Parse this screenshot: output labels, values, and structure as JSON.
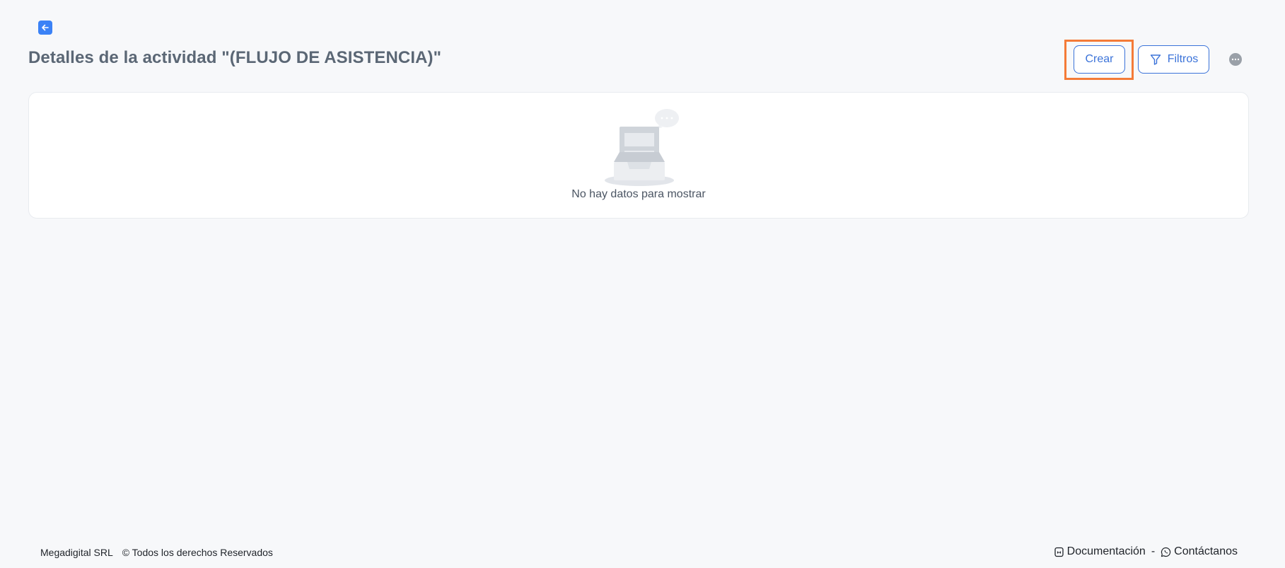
{
  "header": {
    "back_icon": "arrow-left-icon",
    "title": "Detalles de la actividad \"(FLUJO DE ASISTENCIA)\"",
    "crear_label": "Crear",
    "filtros_label": "Filtros",
    "filter_icon": "funnel-icon",
    "more_icon": "ellipsis-icon"
  },
  "empty_state": {
    "illustration": "empty-inbox-icon",
    "message": "No hay datos para mostrar"
  },
  "footer": {
    "company": "Megadigital SRL",
    "copyright": "© Todos los derechos Reservados",
    "docs_label": "Documentación",
    "separator": "-",
    "contact_label": "Contáctanos",
    "docs_icon": "document-icon",
    "contact_icon": "whatsapp-icon"
  },
  "colors": {
    "accent": "#3b82f6",
    "button_text": "#3b73d9",
    "highlight": "#f47b38",
    "background": "#f7f8fa"
  }
}
